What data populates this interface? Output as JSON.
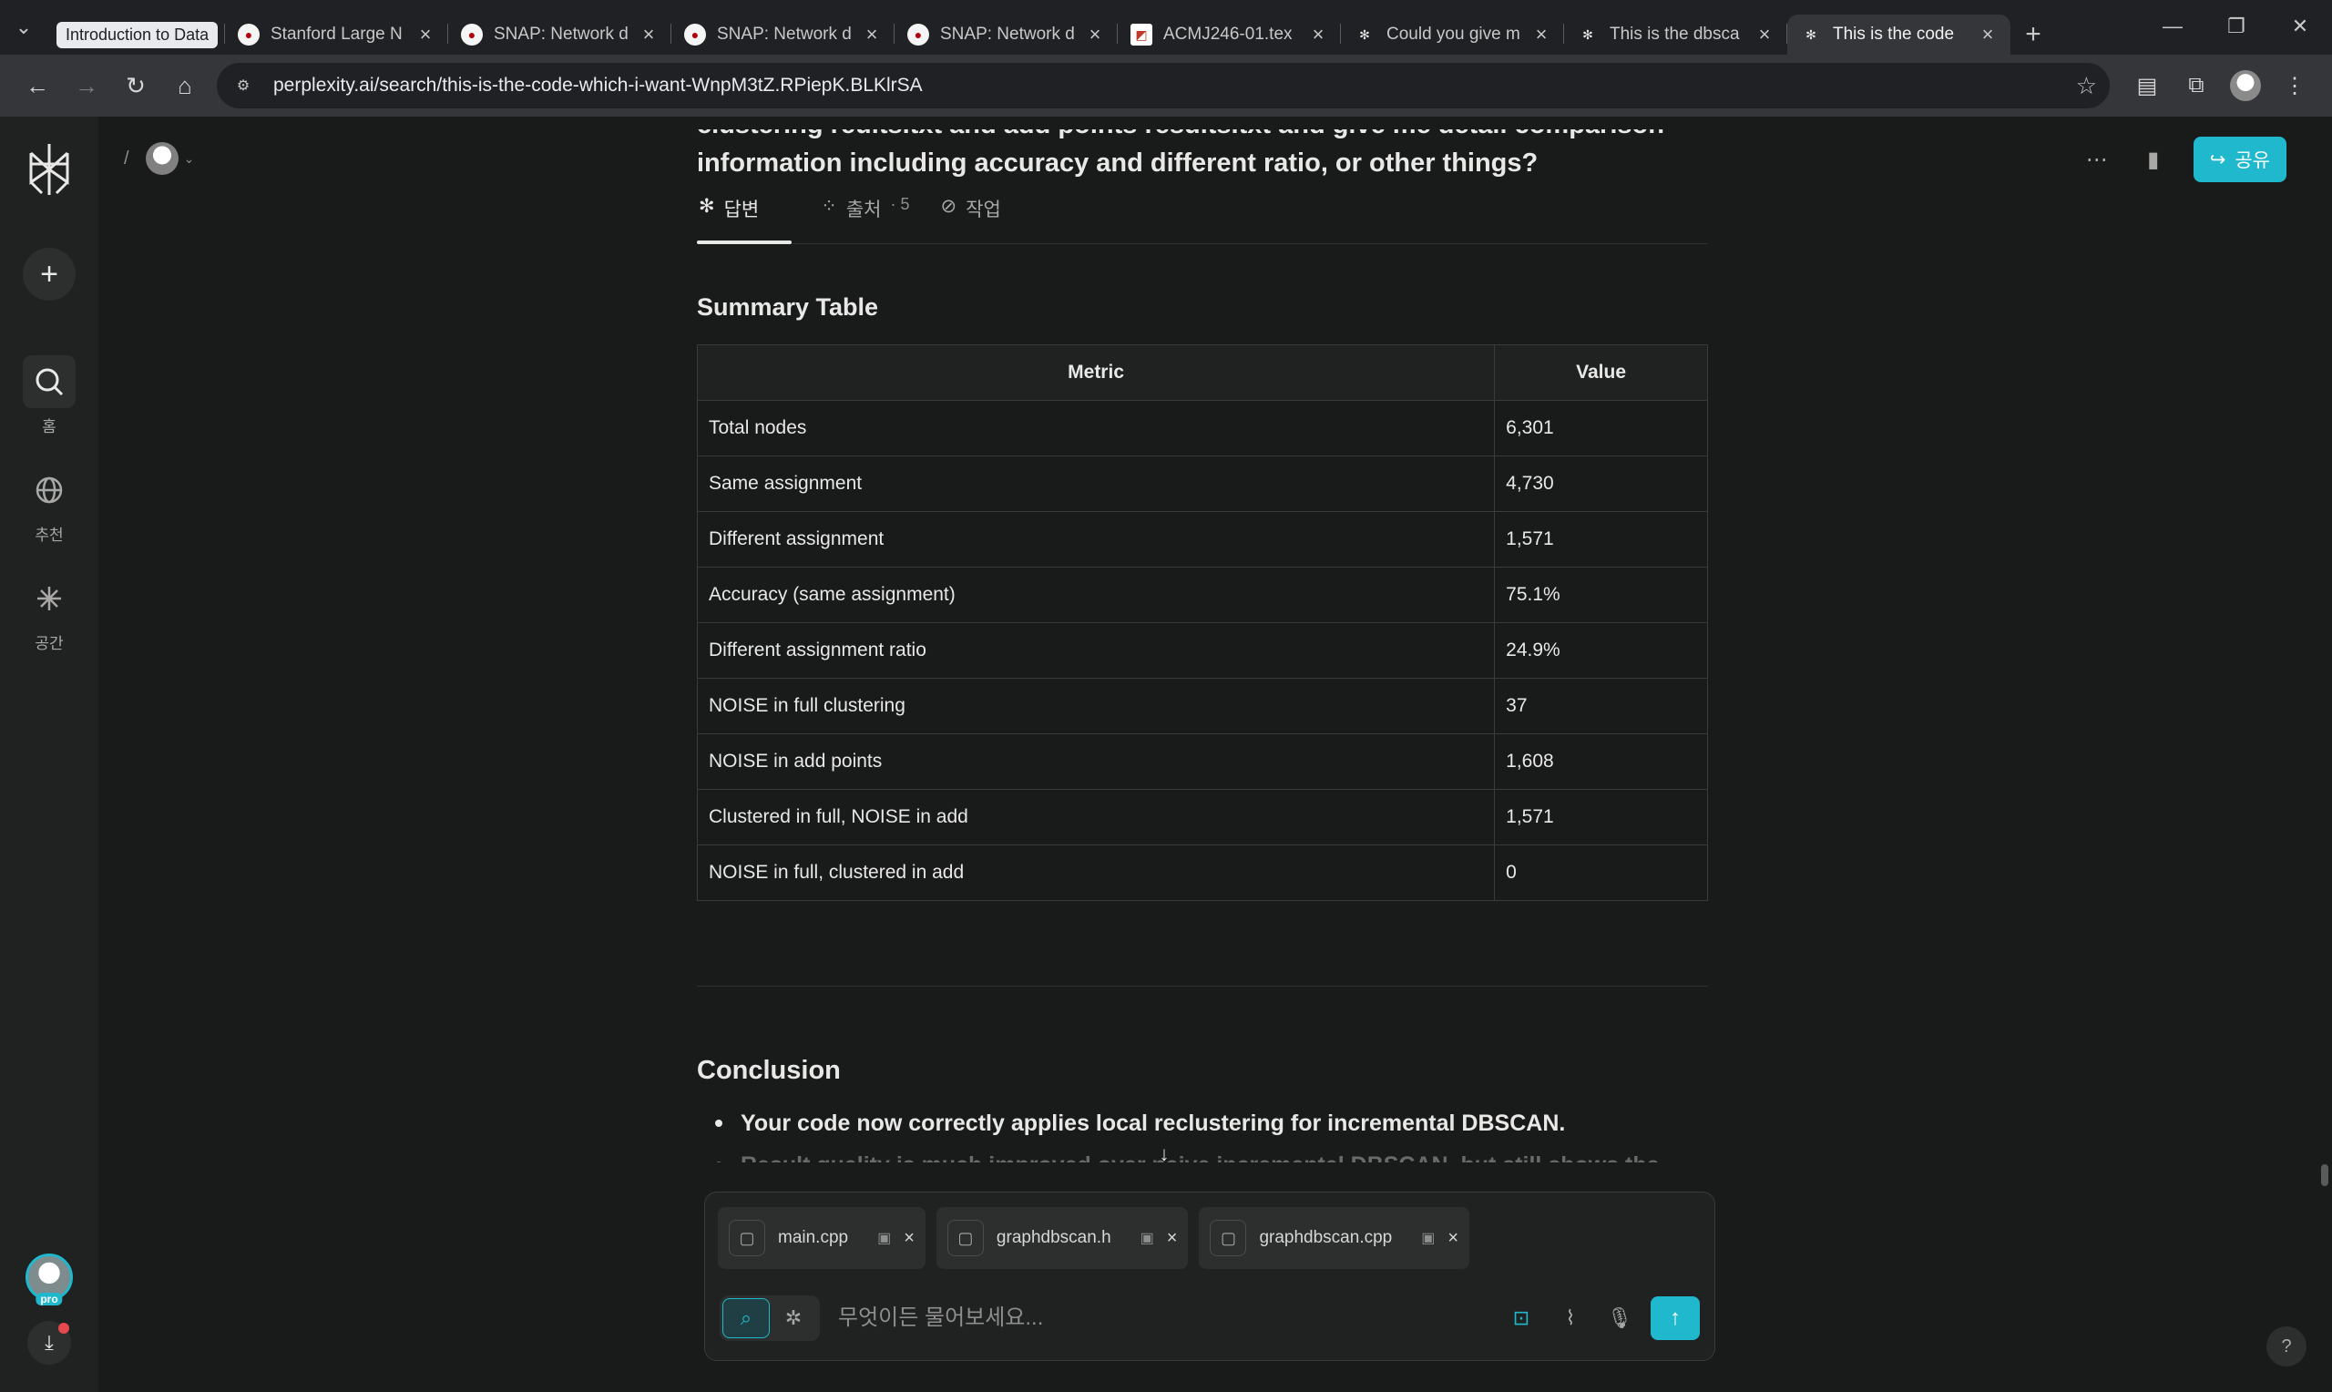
{
  "browser": {
    "tabs": [
      {
        "label": "Introduction to Data",
        "grouped": true
      },
      {
        "label": "Stanford Large N"
      },
      {
        "label": "SNAP: Network d"
      },
      {
        "label": "SNAP: Network d"
      },
      {
        "label": "SNAP: Network d"
      },
      {
        "label": "ACMJ246-01.tex"
      },
      {
        "label": "Could you give m"
      },
      {
        "label": "This is the dbsca"
      },
      {
        "label": "This is the code",
        "active": true
      }
    ],
    "url": "perplexity.ai/search/this-is-the-code-which-i-want-WnpM3tZ.RPiepK.BLKlrSA"
  },
  "sidebar": {
    "items": [
      {
        "label": "홈",
        "icon": "search-home-icon"
      },
      {
        "label": "추천",
        "icon": "globe-icon"
      },
      {
        "label": "공간",
        "icon": "sparkle-icon"
      }
    ],
    "pro_badge": "pro"
  },
  "header": {
    "path_separator": "/",
    "share_label": "공유"
  },
  "question": {
    "line1": "clustering reults.txt and add points results.txt and give me detail comparison",
    "line2": "information including accuracy and different ratio, or other things?"
  },
  "answer_tabs": [
    {
      "label": "답변"
    },
    {
      "label": "출처",
      "count": "· 5"
    },
    {
      "label": "작업"
    }
  ],
  "summary": {
    "title": "Summary Table",
    "columns": [
      "Metric",
      "Value"
    ],
    "rows": [
      [
        "Total nodes",
        "6,301"
      ],
      [
        "Same assignment",
        "4,730"
      ],
      [
        "Different assignment",
        "1,571"
      ],
      [
        "Accuracy (same assignment)",
        "75.1%"
      ],
      [
        "Different assignment ratio",
        "24.9%"
      ],
      [
        "NOISE in full clustering",
        "37"
      ],
      [
        "NOISE in add points",
        "1,608"
      ],
      [
        "Clustered in full, NOISE in add",
        "1,571"
      ],
      [
        "NOISE in full, clustered in add",
        "0"
      ]
    ]
  },
  "conclusion": {
    "title": "Conclusion",
    "bullets": [
      "Your code now correctly applies local reclustering for incremental DBSCAN.",
      "Result quality is much improved over naive incremental DBSCAN, but still shows the known"
    ]
  },
  "composer": {
    "attachments": [
      "main.cpp",
      "graphdbscan.h",
      "graphdbscan.cpp"
    ],
    "placeholder": "무엇이든 물어보세요..."
  },
  "colors": {
    "accent": "#20b8cd",
    "background": "#191a1a",
    "sidebar": "#202222"
  }
}
